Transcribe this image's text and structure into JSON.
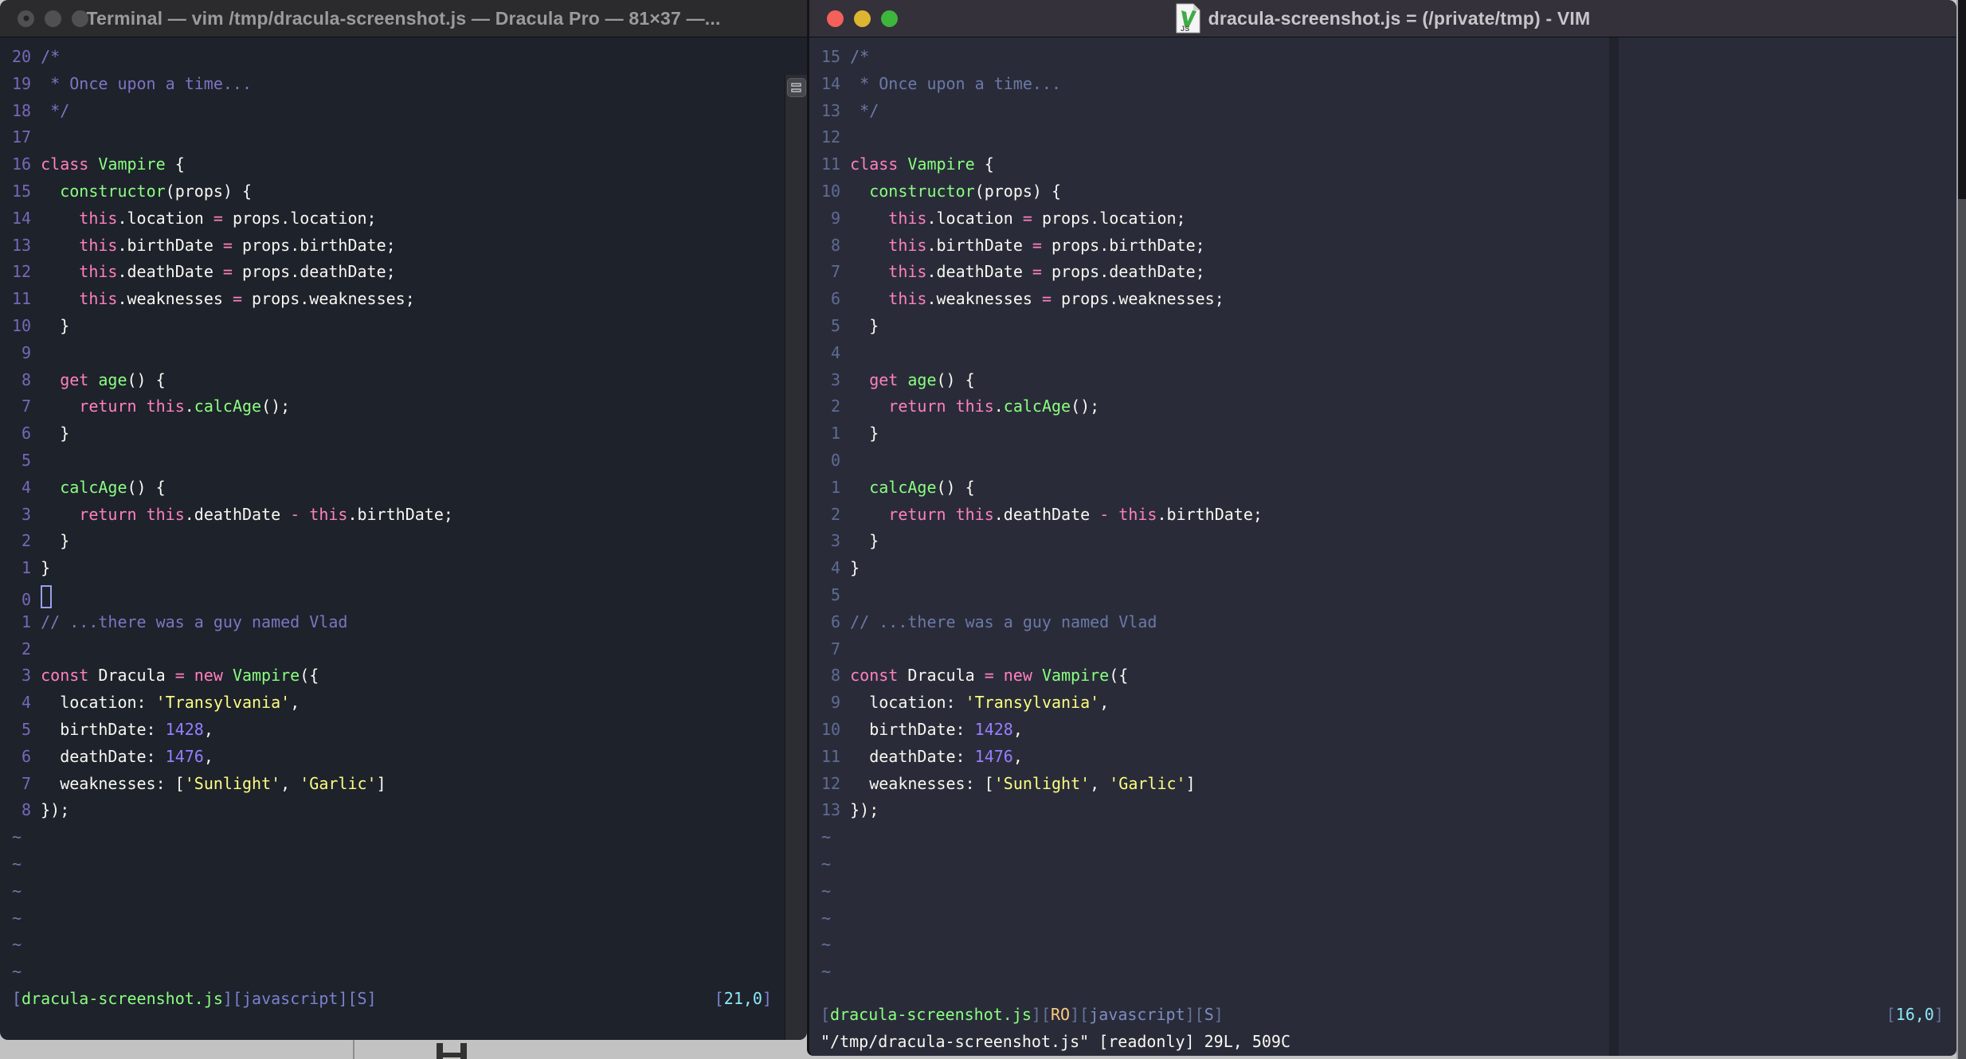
{
  "colors": {
    "terminal_bg": "#1e222b",
    "macvim_bg": "#292c38",
    "foreground": "#f8f8f2",
    "pink": "#ff80bf",
    "green": "#8aff80",
    "yellow": "#fdfd81",
    "purple": "#9580ff",
    "cyan": "#8ce9f8",
    "orange": "#ffca80",
    "comment_left": "#7e74c2",
    "comment_right": "#6b79a8",
    "traffic_red": "#f4605a",
    "traffic_yellow": "#ddb531",
    "traffic_green": "#3eb53b"
  },
  "code_lines": [
    [
      [
        "c",
        "/*"
      ]
    ],
    [
      [
        "c",
        " * Once upon a time..."
      ]
    ],
    [
      [
        "c",
        " */"
      ]
    ],
    [],
    [
      [
        "k",
        "class "
      ],
      [
        "fn",
        "Vampire "
      ],
      [
        "f",
        "{"
      ]
    ],
    [
      [
        "f",
        "  "
      ],
      [
        "fn",
        "constructor"
      ],
      [
        "f",
        "(props) {"
      ]
    ],
    [
      [
        "f",
        "    "
      ],
      [
        "k",
        "this"
      ],
      [
        "f",
        ".location "
      ],
      [
        "k",
        "="
      ],
      [
        "f",
        " props.location;"
      ]
    ],
    [
      [
        "f",
        "    "
      ],
      [
        "k",
        "this"
      ],
      [
        "f",
        ".birthDate "
      ],
      [
        "k",
        "="
      ],
      [
        "f",
        " props.birthDate;"
      ]
    ],
    [
      [
        "f",
        "    "
      ],
      [
        "k",
        "this"
      ],
      [
        "f",
        ".deathDate "
      ],
      [
        "k",
        "="
      ],
      [
        "f",
        " props.deathDate;"
      ]
    ],
    [
      [
        "f",
        "    "
      ],
      [
        "k",
        "this"
      ],
      [
        "f",
        ".weaknesses "
      ],
      [
        "k",
        "="
      ],
      [
        "f",
        " props.weaknesses;"
      ]
    ],
    [
      [
        "f",
        "  }"
      ]
    ],
    [],
    [
      [
        "f",
        "  "
      ],
      [
        "k",
        "get "
      ],
      [
        "fn",
        "age"
      ],
      [
        "f",
        "() {"
      ]
    ],
    [
      [
        "f",
        "    "
      ],
      [
        "k",
        "return "
      ],
      [
        "k",
        "this"
      ],
      [
        "f",
        "."
      ],
      [
        "fn",
        "calcAge"
      ],
      [
        "f",
        "();"
      ]
    ],
    [
      [
        "f",
        "  }"
      ]
    ],
    [],
    [
      [
        "f",
        "  "
      ],
      [
        "fn",
        "calcAge"
      ],
      [
        "f",
        "() {"
      ]
    ],
    [
      [
        "f",
        "    "
      ],
      [
        "k",
        "return "
      ],
      [
        "k",
        "this"
      ],
      [
        "f",
        ".deathDate "
      ],
      [
        "k",
        "-"
      ],
      [
        "f",
        " "
      ],
      [
        "k",
        "this"
      ],
      [
        "f",
        ".birthDate;"
      ]
    ],
    [
      [
        "f",
        "  }"
      ]
    ],
    [
      [
        "f",
        "}"
      ]
    ],
    [],
    [
      [
        "c",
        "// ...there was a guy named Vlad"
      ]
    ],
    [],
    [
      [
        "k",
        "const "
      ],
      [
        "f",
        "Dracula "
      ],
      [
        "k",
        "= new "
      ],
      [
        "fn",
        "Vampire"
      ],
      [
        "f",
        "({"
      ]
    ],
    [
      [
        "f",
        "  location: "
      ],
      [
        "s",
        "'Transylvania'"
      ],
      [
        "f",
        ","
      ]
    ],
    [
      [
        "f",
        "  birthDate: "
      ],
      [
        "num",
        "1428"
      ],
      [
        "f",
        ","
      ]
    ],
    [
      [
        "f",
        "  deathDate: "
      ],
      [
        "num",
        "1476"
      ],
      [
        "f",
        ","
      ]
    ],
    [
      [
        "f",
        "  weaknesses: ["
      ],
      [
        "s",
        "'Sunlight'"
      ],
      [
        "f",
        ", "
      ],
      [
        "s",
        "'Garlic'"
      ],
      [
        "f",
        "]"
      ]
    ],
    [
      [
        "f",
        "});"
      ]
    ]
  ],
  "left_window": {
    "title": "Terminal — vim /tmp/dracula-screenshot.js — Dracula Pro — 81×37 —...",
    "numbers": [
      "20",
      "19",
      "18",
      "17",
      "16",
      "15",
      "14",
      "13",
      "12",
      "11",
      "10",
      "9",
      "8",
      "7",
      "6",
      "5",
      "4",
      "3",
      "2",
      "1",
      "0",
      "1",
      "2",
      "3",
      "4",
      "5",
      "6",
      "7",
      "8"
    ],
    "cursor_line_index": 20,
    "tilde_count": 6,
    "tilde": "~",
    "status_tokens": [
      [
        "pu",
        "["
      ],
      [
        "gr",
        "dracula-screenshot.js"
      ],
      [
        "pu",
        "]["
      ],
      [
        "bl",
        "javascript"
      ],
      [
        "pu",
        "]["
      ],
      [
        "bl",
        "S"
      ],
      [
        "pu",
        "]"
      ]
    ],
    "ruler_tokens": [
      [
        "pu",
        "["
      ],
      [
        "cy",
        "21,0"
      ],
      [
        "pu",
        "]"
      ]
    ]
  },
  "right_window": {
    "title": "dracula-screenshot.js = (/private/tmp) - VIM",
    "numbers": [
      "15",
      "14",
      "13",
      "12",
      "11",
      "10",
      "9",
      "8",
      "7",
      "6",
      "5",
      "4",
      "3",
      "2",
      "1",
      "0",
      "1",
      "2",
      "3",
      "4",
      "5",
      "6",
      "7",
      "8",
      "9",
      "10",
      "11",
      "12",
      "13"
    ],
    "cursor_line_index": -1,
    "tilde_count": 6,
    "tilde": "~",
    "status_tokens": [
      [
        "pu",
        "["
      ],
      [
        "gr",
        "dracula-screenshot.js"
      ],
      [
        "pu",
        "]["
      ],
      [
        "or",
        "RO"
      ],
      [
        "pu",
        "]["
      ],
      [
        "bl",
        "javascript"
      ],
      [
        "pu",
        "]["
      ],
      [
        "bl",
        "S"
      ],
      [
        "pu",
        "]"
      ]
    ],
    "ruler_tokens": [
      [
        "pu",
        "["
      ],
      [
        "cy",
        "16,0"
      ],
      [
        "pu",
        "]"
      ]
    ],
    "command_line": "\"/tmp/dracula-screenshot.js\" [readonly] 29L, 509C"
  }
}
